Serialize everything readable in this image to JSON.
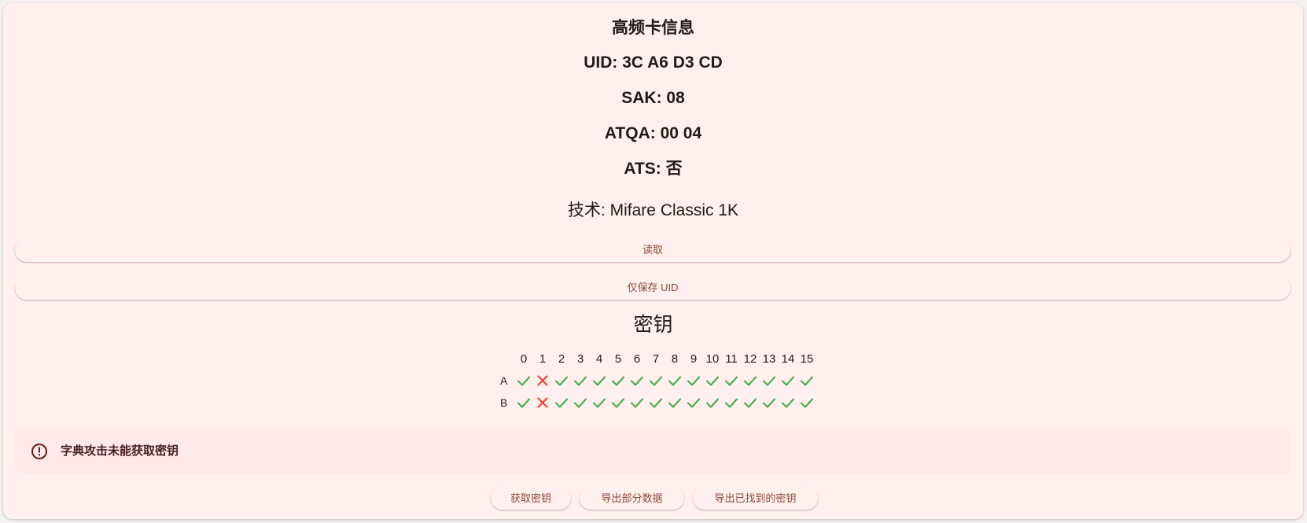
{
  "card": {
    "title": "高频卡信息",
    "uid": "UID: 3C A6 D3 CD",
    "sak": "SAK: 08",
    "atqa": "ATQA: 00 04",
    "ats": "ATS: 否",
    "tech": "技术: Mifare Classic 1K"
  },
  "buttons": {
    "read": "读取",
    "save_uid": "仅保存 UID"
  },
  "keys": {
    "title": "密钥",
    "sectors": [
      "0",
      "1",
      "2",
      "3",
      "4",
      "5",
      "6",
      "7",
      "8",
      "9",
      "10",
      "11",
      "12",
      "13",
      "14",
      "15"
    ],
    "rows": [
      {
        "label": "A",
        "found": [
          true,
          false,
          true,
          true,
          true,
          true,
          true,
          true,
          true,
          true,
          true,
          true,
          true,
          true,
          true,
          true
        ]
      },
      {
        "label": "B",
        "found": [
          true,
          false,
          true,
          true,
          true,
          true,
          true,
          true,
          true,
          true,
          true,
          true,
          true,
          true,
          true,
          true
        ]
      }
    ],
    "found_color": "#4caf50",
    "missing_color": "#f44336"
  },
  "alert": {
    "icon": "error-circle-icon",
    "message": "字典攻击未能获取密钥"
  },
  "actions": {
    "get_keys": "获取密钥",
    "export_partial": "导出部分数据",
    "export_found_keys": "导出已找到的密钥"
  }
}
